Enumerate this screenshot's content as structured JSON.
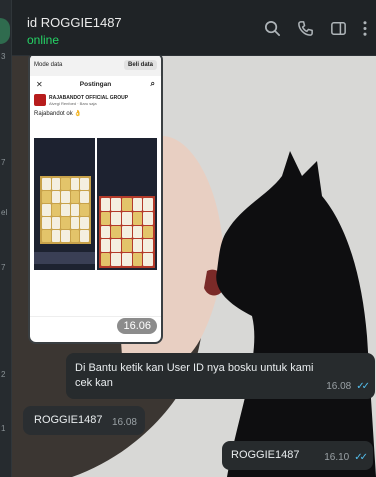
{
  "sidebar": {
    "digits": [
      "3",
      "7",
      "el",
      "7",
      "2",
      "1"
    ]
  },
  "header": {
    "contact_name": "id ROGGIE1487",
    "status": "online",
    "icons": [
      "search-icon",
      "phone-icon",
      "sidebar-toggle-icon",
      "more-menu-icon"
    ]
  },
  "image_message": {
    "time": "16.06",
    "screenshot": {
      "mode_label": "Mode data",
      "data_button": "Beli data",
      "nav_title": "Postingan",
      "group_name": "RAJABANDOT OFFICIAL GROUP",
      "group_sub": "Alvegi Renfoed · Baru saja",
      "post_text": "Rajabandot ok 👌"
    }
  },
  "messages": [
    {
      "text": "Di Bantu ketik kan User ID nya bosku untuk kami cek kan",
      "time": "16.08",
      "direction": "out",
      "read": true
    },
    {
      "text": "ROGGIE1487",
      "time": "16.08",
      "direction": "in",
      "read": false
    },
    {
      "text": "ROGGIE1487",
      "time": "16.10",
      "direction": "out",
      "read": true
    }
  ],
  "colors": {
    "online": "#25d366",
    "read_ticks": "#53bdeb",
    "bubble": "#272b2d"
  }
}
